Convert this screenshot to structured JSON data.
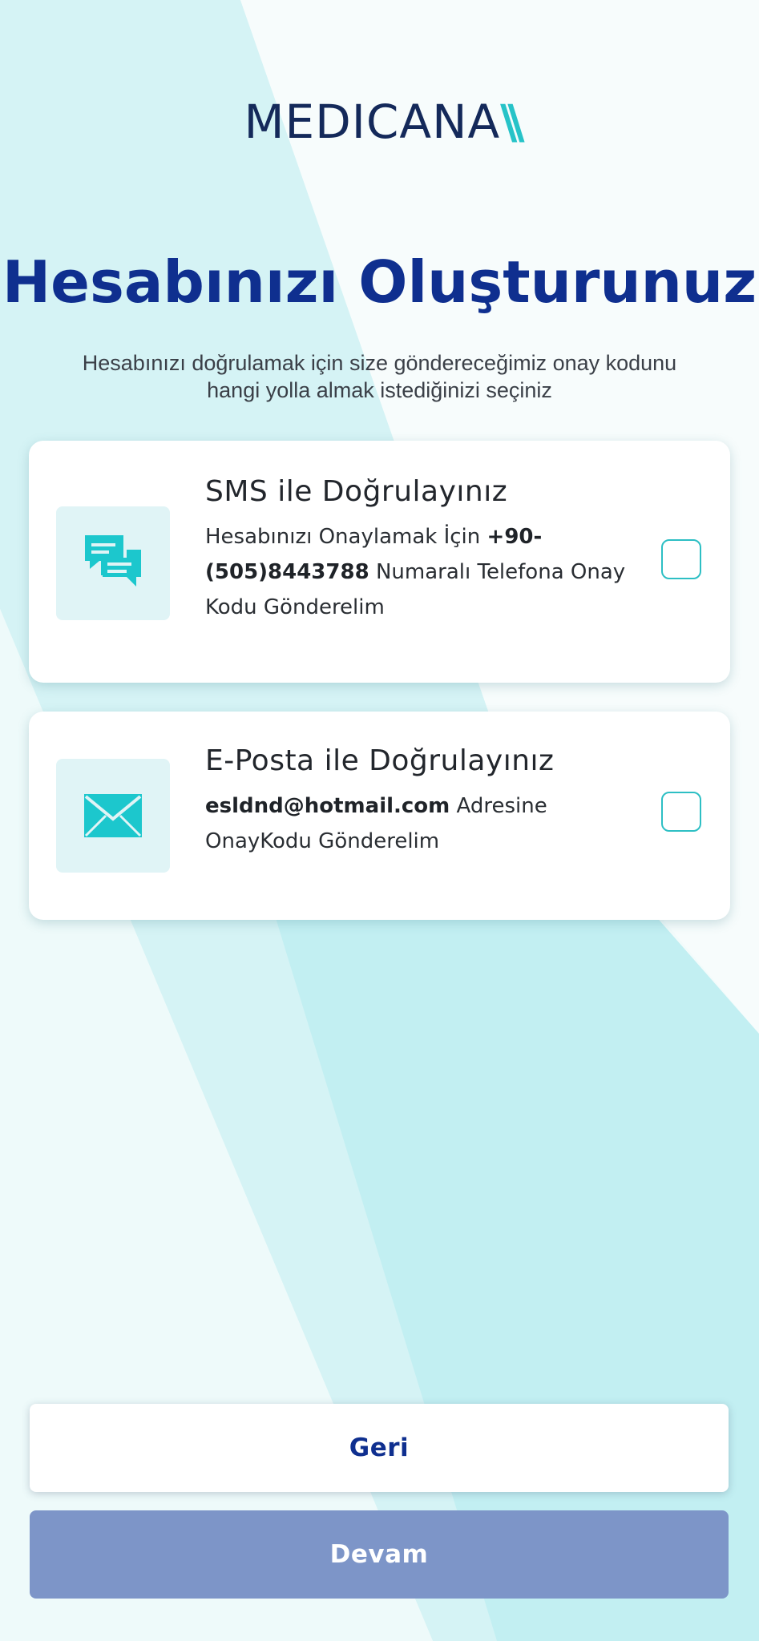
{
  "brand": {
    "name": "MEDICANA",
    "mark": "\\\\"
  },
  "page": {
    "title": "Hesabınızı Oluşturunuz",
    "subtitle_line1": "Hesabınızı doğrulamak için size göndereceğimiz onay kodunu",
    "subtitle_line2": "hangi yolla almak istediğinizi seçiniz"
  },
  "options": {
    "sms": {
      "title": "SMS ile Doğrulayınız",
      "desc_prefix": "Hesabınızı Onaylamak İçin ",
      "phone": "+90-(505)8443788",
      "desc_suffix": " Numaralı Telefona Onay Kodu Gönderelim",
      "icon": "chat-bubbles-icon",
      "checked": false
    },
    "email": {
      "title": "E-Posta ile Doğrulayınız",
      "email": "esldnd@hotmail.com",
      "desc_suffix": " Adresine OnayKodu Gönderelim",
      "icon": "envelope-icon",
      "checked": false
    }
  },
  "buttons": {
    "back": "Geri",
    "next": "Devam"
  },
  "colors": {
    "primary": "#0f2f8f",
    "accent": "#27c3c8",
    "disabled_button": "#7d95c8",
    "icon_bg": "#e0f4f6"
  }
}
